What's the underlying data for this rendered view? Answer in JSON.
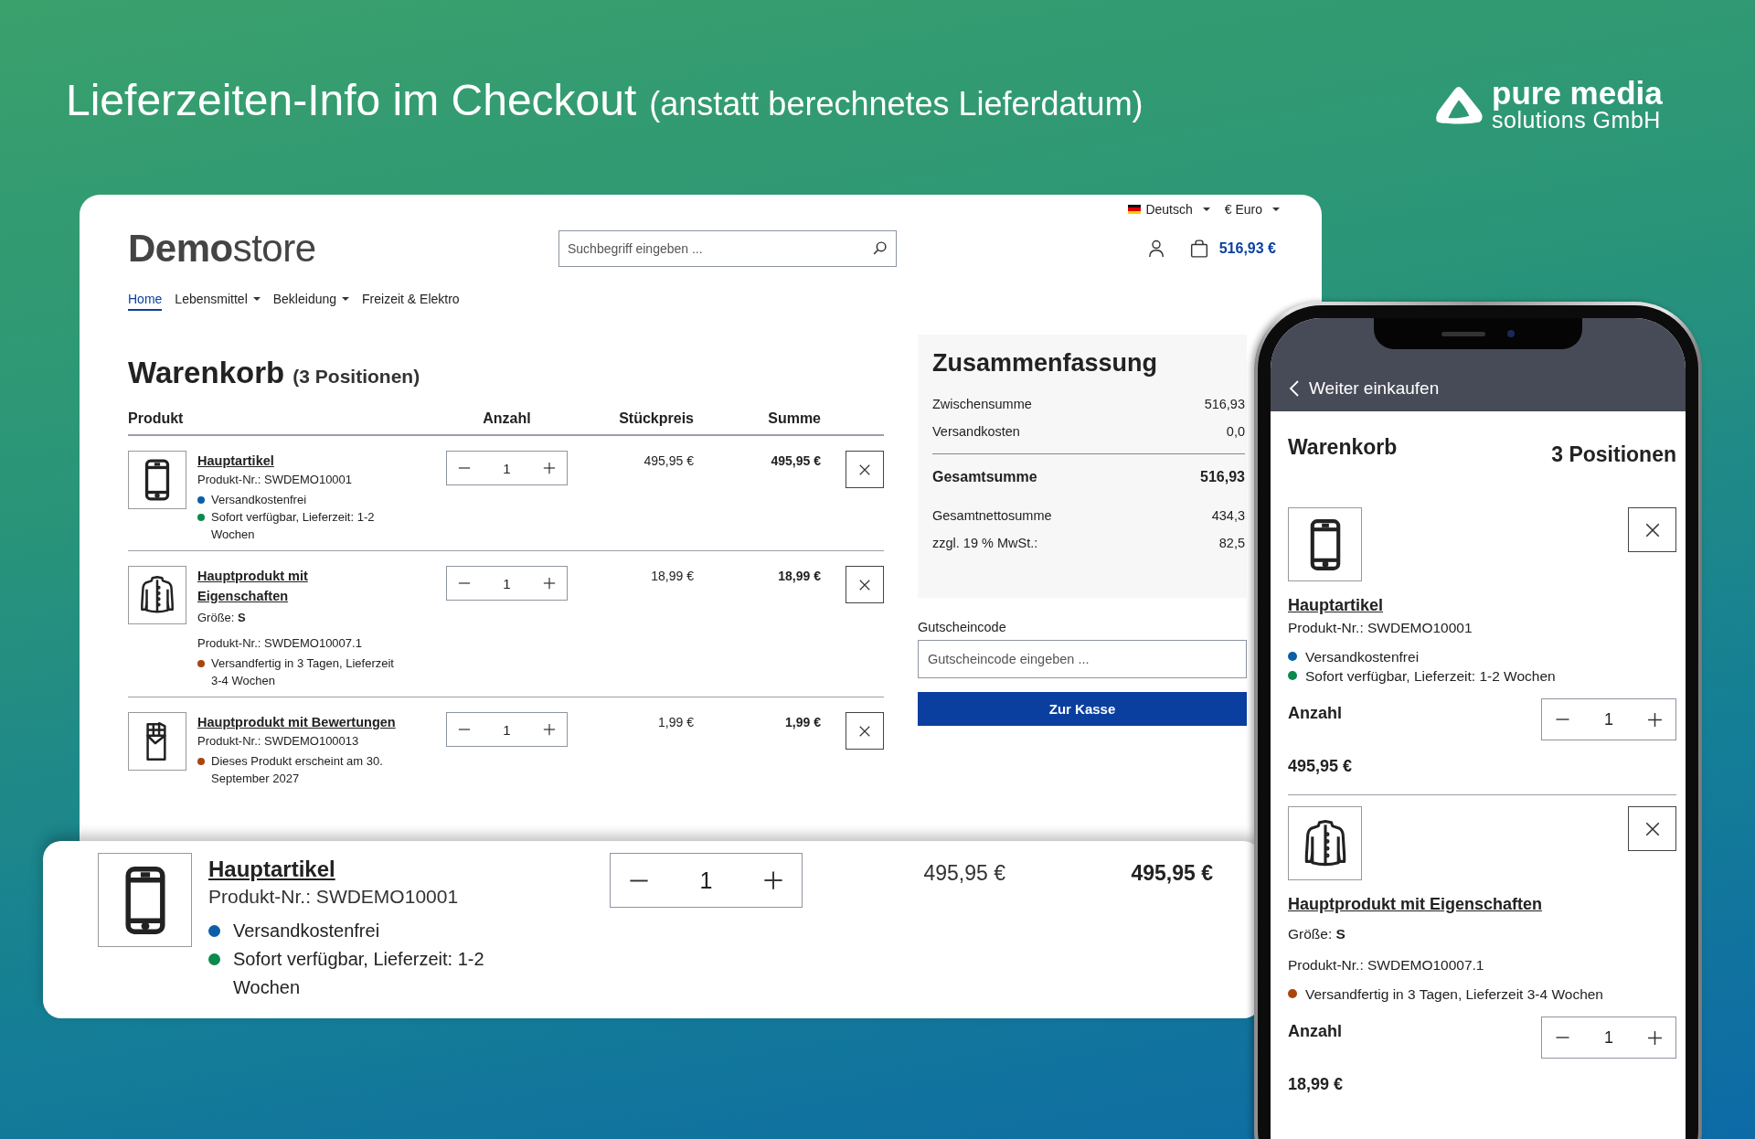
{
  "headline": {
    "title": "Lieferzeiten-Info im Checkout",
    "subtitle": "(anstatt berechnetes Lieferdatum)"
  },
  "brand": {
    "name": "pure media",
    "tagline": "solutions GmbH"
  },
  "desktop": {
    "language": "Deutsch",
    "currency": "€ Euro",
    "logo": {
      "bold": "Demo",
      "light": "store"
    },
    "search": {
      "placeholder": "Suchbegriff eingeben ..."
    },
    "cart_total": "516,93 €",
    "nav": [
      {
        "label": "Home",
        "selected": true,
        "dropdown": false
      },
      {
        "label": "Lebensmittel",
        "selected": false,
        "dropdown": true
      },
      {
        "label": "Bekleidung",
        "selected": false,
        "dropdown": true
      },
      {
        "label": "Freizeit & Elektro",
        "selected": false,
        "dropdown": false
      }
    ],
    "cart": {
      "title": "Warenkorb",
      "count": "(3 Positionen)",
      "columns": [
        "Produkt",
        "Anzahl",
        "Stückpreis",
        "Summe"
      ],
      "items": [
        {
          "kind": "phone",
          "name": "Hauptartikel",
          "number": "Produkt-Nr.: SWDEMO10001",
          "badges": [
            {
              "text": "Versandkostenfrei",
              "color": "#0b5ea8"
            },
            {
              "text": "Sofort verfügbar, Lieferzeit: 1-2 Wochen",
              "color": "#0b8a4e"
            }
          ],
          "quantity": "1",
          "unit_price": "495,95 €",
          "total": "495,95 €"
        },
        {
          "kind": "jacket",
          "name": "Hauptprodukt mit Eigenschaften",
          "attributes": [
            "Größe: **S**"
          ],
          "number": "Produkt-Nr.: SWDEMO10007.1",
          "badges": [
            {
              "text": "Versandfertig in 3 Tagen, Lieferzeit 3-4 Wochen",
              "color": "#a8460e"
            }
          ],
          "quantity": "1",
          "unit_price": "18,99 €",
          "total": "18,99 €"
        },
        {
          "kind": "chocolate",
          "name": "Hauptprodukt mit Bewertungen",
          "number": "Produkt-Nr.: SWDEMO100013",
          "badges": [
            {
              "text": "Dieses Produkt erscheint am 30. September 2027",
              "color": "#a8460e"
            }
          ],
          "quantity": "1",
          "unit_price": "1,99 €",
          "total": "1,99 €"
        }
      ]
    },
    "summary": {
      "title": "Zusammenfassung",
      "rows": [
        {
          "kind": "normal",
          "label": "Zwischensumme",
          "value": "516,93"
        },
        {
          "kind": "normal",
          "label": "Versandkosten",
          "value": "0,0"
        },
        {
          "kind": "total",
          "label": "Gesamtsumme",
          "value": "516,93"
        },
        {
          "kind": "normal",
          "label": "Gesamtnettosumme",
          "value": "434,3"
        },
        {
          "kind": "normal",
          "label": "zzgl. 19 % MwSt.:",
          "value": "82,5"
        }
      ]
    },
    "coupon": {
      "label": "Gutscheincode",
      "placeholder": "Gutscheincode eingeben ..."
    },
    "checkout_button": "Zur Kasse"
  },
  "zoomed_item": {
    "kind": "phone",
    "name": "Hauptartikel",
    "number": "Produkt-Nr.: SWDEMO10001",
    "badges": [
      {
        "text": "Versandkostenfrei",
        "color": "#0b5ea8"
      },
      {
        "text": "Sofort verfügbar, Lieferzeit: 1-2 Wochen",
        "color": "#0b8a4e"
      }
    ],
    "quantity": "1",
    "unit_price": "495,95 €",
    "total": "495,95 €"
  },
  "mobile": {
    "back": "Weiter einkaufen",
    "title": "Warenkorb",
    "count": "3 Positionen",
    "items": [
      {
        "kind": "phone",
        "name": "Hauptartikel",
        "number": "Produkt-Nr.: SWDEMO10001",
        "badges": [
          {
            "text": "Versandkostenfrei",
            "color": "#0b5ea8"
          },
          {
            "text": "Sofort verfügbar, Lieferzeit: 1-2 Wochen",
            "color": "#0b8a4e"
          }
        ],
        "quantity_label": "Anzahl",
        "quantity": "1",
        "price": "495,95 €"
      },
      {
        "kind": "jacket",
        "name": "Hauptprodukt mit Eigenschaften",
        "attributes": [
          "Größe: **S**"
        ],
        "number": "Produkt-Nr.: SWDEMO10007.1",
        "badges": [
          {
            "text": "Versandfertig in 3 Tagen, Lieferzeit 3-4 Wochen",
            "color": "#a8460e"
          }
        ],
        "quantity_label": "Anzahl",
        "quantity": "1",
        "price": "18,99 €"
      }
    ]
  }
}
